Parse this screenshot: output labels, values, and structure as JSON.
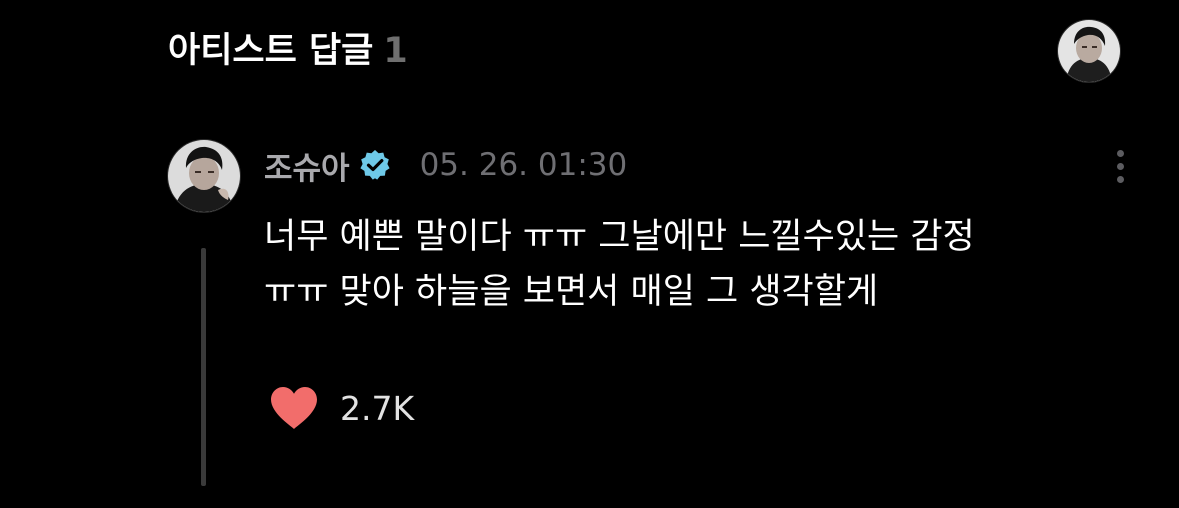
{
  "header": {
    "title": "아티스트 답글",
    "count": "1"
  },
  "comment": {
    "author": "조슈아",
    "timestamp": "05. 26. 01:30",
    "body_lines": [
      "너무 예쁜 말이다 ㅠㅠ 그날에만 느낄수있는 감정",
      "ㅠㅠ 맞아 하늘을 보면서 매일 그 생각할게"
    ],
    "like_count": "2.7K"
  },
  "icons": {
    "header_avatar": "profile-avatar",
    "comment_avatar": "profile-avatar",
    "verified": "verified-badge-icon",
    "more": "more-vertical-icon",
    "like": "heart-icon"
  },
  "colors": {
    "background": "#000000",
    "heart": "#f26d6b",
    "verified_badge": "#6ec9e8",
    "name": "#a9a9ad",
    "time": "#6f6f73"
  }
}
